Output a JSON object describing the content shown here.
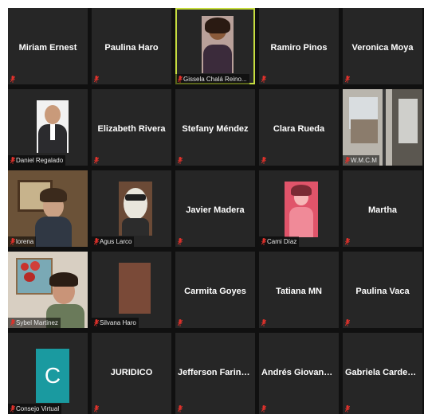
{
  "accent": "#c6dd3f",
  "mic_icon": "mic-muted-icon",
  "participants": [
    {
      "name": "Miriam Ernest",
      "label": "",
      "video": false
    },
    {
      "name": "Paulina Haro",
      "label": "",
      "video": false
    },
    {
      "name": "",
      "label": "Gissela Chalá Reino...",
      "video": true,
      "active": true
    },
    {
      "name": "Ramiro Pinos",
      "label": "",
      "video": false
    },
    {
      "name": "Veronica Moya",
      "label": "",
      "video": false
    },
    {
      "name": "",
      "label": "Daniel Regalado",
      "video": true
    },
    {
      "name": "Elizabeth Rivera",
      "label": "",
      "video": false
    },
    {
      "name": "Stefany Méndez",
      "label": "",
      "video": false
    },
    {
      "name": "Clara Rueda",
      "label": "",
      "video": false
    },
    {
      "name": "",
      "label": "W.M.C.M",
      "video": true
    },
    {
      "name": "",
      "label": "lorena",
      "video": true
    },
    {
      "name": "",
      "label": "Agus Larco",
      "video": true
    },
    {
      "name": "Javier Madera",
      "label": "",
      "video": false
    },
    {
      "name": "",
      "label": "Cami Díaz",
      "video": true
    },
    {
      "name": "Martha",
      "label": "",
      "video": false
    },
    {
      "name": "",
      "label": "Sybel Martinez",
      "video": true
    },
    {
      "name": "",
      "label": "Silvana Haro",
      "video": true
    },
    {
      "name": "Carmita Goyes",
      "label": "",
      "video": false
    },
    {
      "name": "Tatiana MN",
      "label": "",
      "video": false
    },
    {
      "name": "Paulina Vaca",
      "label": "",
      "video": false
    },
    {
      "name": "",
      "label": "Consejo Virtual",
      "video": true,
      "avatar_letter": "C"
    },
    {
      "name": "JURIDICO",
      "label": "",
      "video": false
    },
    {
      "name": "Jefferson Farina...",
      "label": "",
      "video": false
    },
    {
      "name": "Andrés Giovann...",
      "label": "",
      "video": false
    },
    {
      "name": "Gabriela Cardenas",
      "label": "",
      "video": false
    }
  ]
}
